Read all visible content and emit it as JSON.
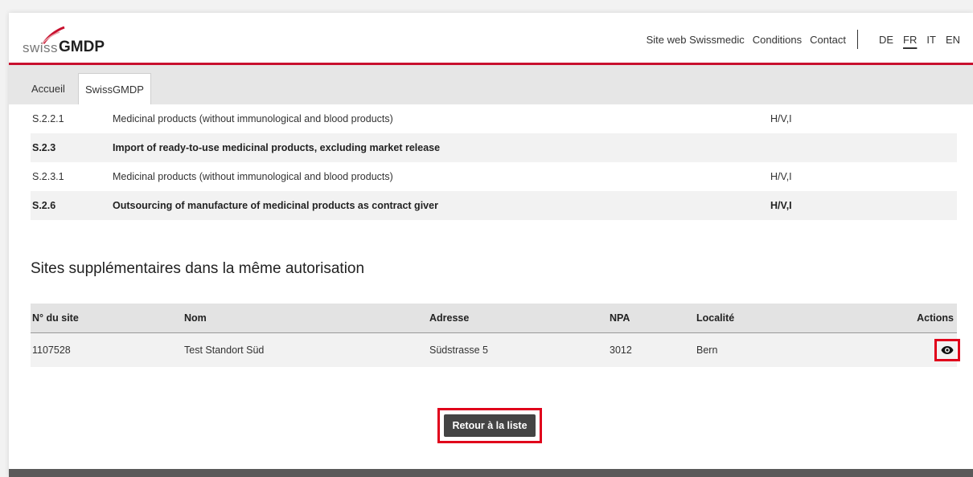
{
  "header": {
    "logo_swiss": "swiss",
    "logo_gmdp": "GMDP",
    "links": [
      "Site web Swissmedic",
      "Conditions",
      "Contact"
    ],
    "languages": [
      "DE",
      "FR",
      "IT",
      "EN"
    ],
    "active_language": "FR"
  },
  "tabs": [
    "Accueil",
    "SwissGMDP"
  ],
  "activities": [
    {
      "code": "S.2.2.1",
      "desc": "Medicinal products (without immunological and blood products)",
      "scope": "H/V,I"
    },
    {
      "code": "S.2.3",
      "desc": "Import of ready-to-use medicinal products, excluding market release",
      "scope": ""
    },
    {
      "code": "S.2.3.1",
      "desc": "Medicinal products (without immunological and blood products)",
      "scope": "H/V,I"
    },
    {
      "code": "S.2.6",
      "desc": "Outsourcing of manufacture of medicinal products as contract giver",
      "scope": "H/V,I"
    }
  ],
  "sites_section": {
    "title": "Sites supplémentaires dans la même autorisation",
    "columns": [
      "N° du site",
      "Nom",
      "Adresse",
      "NPA",
      "Localité",
      "Actions"
    ],
    "rows": [
      {
        "site_no": "1107528",
        "name": "Test Standort Süd",
        "address": "Südstrasse 5",
        "npa": "3012",
        "locality": "Bern",
        "action_icon": "eye-icon"
      }
    ]
  },
  "buttons": {
    "back_to_list": "Retour à la liste"
  },
  "colors": {
    "brand_red": "#c8102e",
    "highlight_red": "#e0001b",
    "button_dark": "#444444"
  }
}
